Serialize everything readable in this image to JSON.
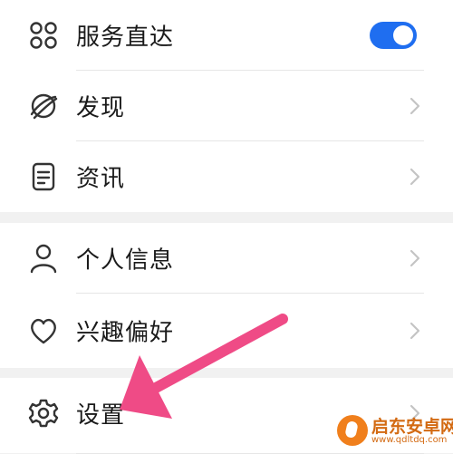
{
  "menu": {
    "group1": [
      {
        "label": "服务直达",
        "icon": "grid-four-circles-icon",
        "control": "toggle",
        "toggle_on": true
      },
      {
        "label": "发现",
        "icon": "planet-icon",
        "control": "chevron"
      },
      {
        "label": "资讯",
        "icon": "document-icon",
        "control": "chevron"
      }
    ],
    "group2": [
      {
        "label": "个人信息",
        "icon": "person-icon",
        "control": "chevron"
      },
      {
        "label": "兴趣偏好",
        "icon": "heart-icon",
        "control": "chevron"
      }
    ],
    "group3": [
      {
        "label": "设置",
        "icon": "gear-icon",
        "control": "chevron"
      }
    ]
  },
  "colors": {
    "toggle_on": "#1f6ef0",
    "annotation_arrow": "#ef4b86",
    "page_background": "#f1f1f1",
    "row_background": "#ffffff"
  },
  "watermark": {
    "name": "启东安卓网",
    "url": "www.qdltdq.com"
  }
}
